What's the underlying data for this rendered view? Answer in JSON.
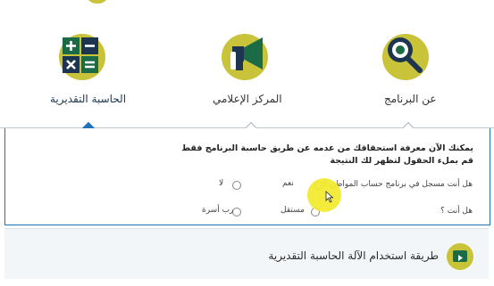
{
  "features": [
    {
      "id": "calculator",
      "label": "الحاسبة التقديرية",
      "active": true
    },
    {
      "id": "media",
      "label": "المركز الإعلامي",
      "active": false
    },
    {
      "id": "about",
      "label": "عن البرنامج",
      "active": false
    }
  ],
  "form": {
    "intro": "يمكنك الآن معرفة استحقاقك من عدمه عن طريق حاسبة البرنامج فقط قم بملء الحقول لتظهر لك النتيجة",
    "q1": {
      "label": "هل أنت مسجل في برنامج حساب المواطن ؟",
      "opt_yes": "نعم",
      "opt_no": "لا"
    },
    "q2": {
      "label": "هل أنت ؟",
      "opt_independent": "مستقل",
      "opt_head": "رب أسرة"
    }
  },
  "bottom": {
    "title": "طريقة استخدام الآلة الحاسبة التقديرية"
  },
  "colors": {
    "accent": "#c9c33a",
    "blue": "#1f73b7",
    "navy": "#1d3550",
    "green": "#1c6b47",
    "halo": "#f2ea2c"
  }
}
